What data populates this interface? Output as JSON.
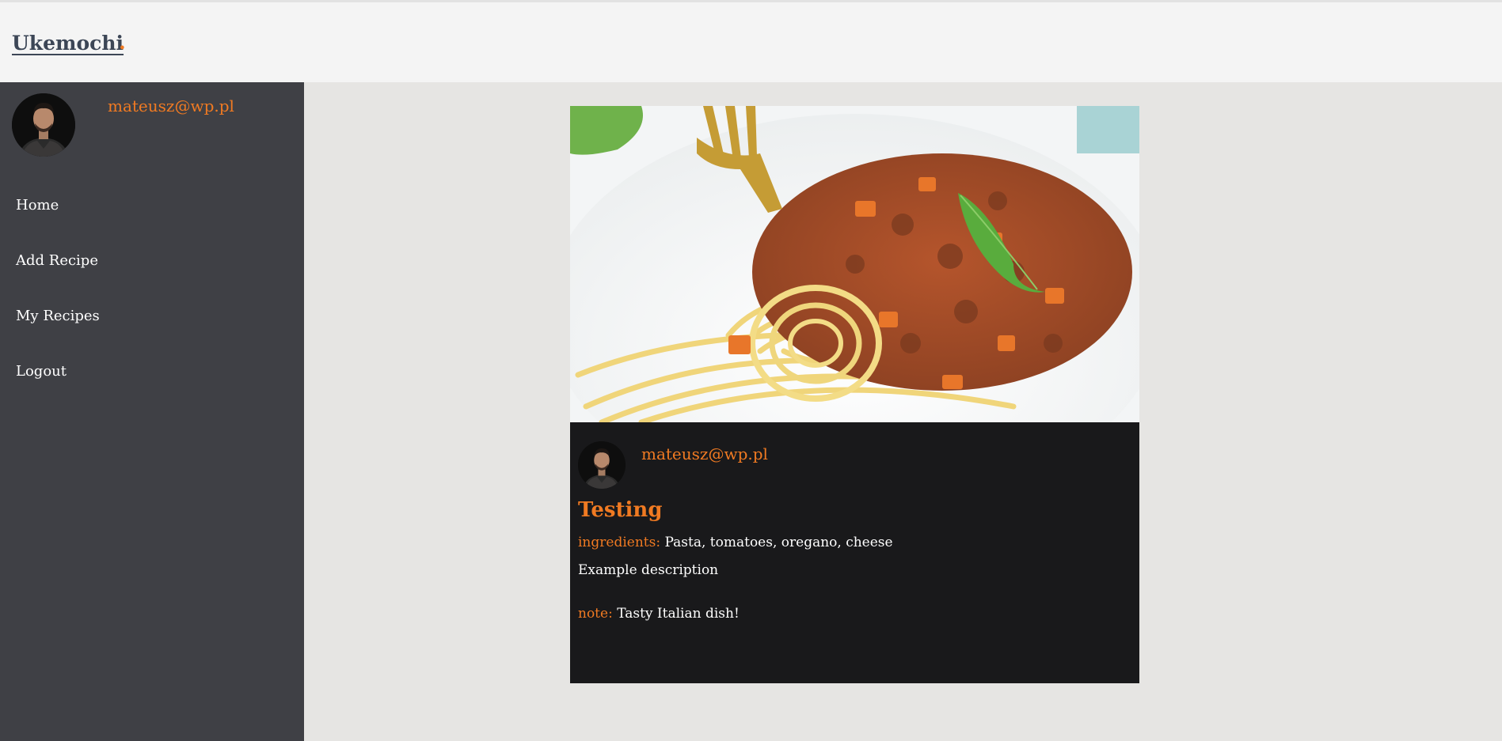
{
  "header": {
    "brand": "Ukemochi",
    "brand_dot": "."
  },
  "sidebar": {
    "user_email": "mateusz@wp.pl",
    "nav": [
      {
        "label": "Home"
      },
      {
        "label": "Add Recipe"
      },
      {
        "label": "My Recipes"
      },
      {
        "label": "Logout"
      }
    ]
  },
  "recipe": {
    "author_email": "mateusz@wp.pl",
    "title": "Testing",
    "ingredients_label": "ingredients:",
    "ingredients": "Pasta, tomatoes, oregano, cheese",
    "description": "Example description",
    "note_label": "note:",
    "note": "Tasty Italian dish!"
  },
  "colors": {
    "accent": "#f07a22",
    "sidebar_bg": "#3f4045",
    "card_bg": "#19191b",
    "page_bg": "#e6e5e3"
  }
}
